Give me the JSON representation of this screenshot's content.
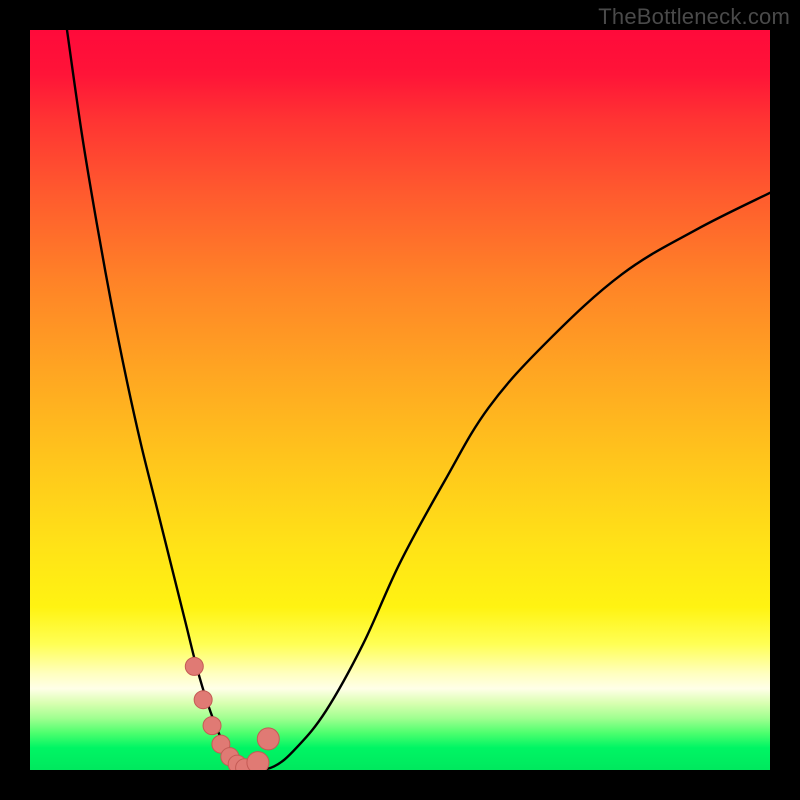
{
  "watermark": "TheBottleneck.com",
  "colors": {
    "frame": "#000000",
    "curve": "#000000",
    "markers_fill": "#e07a74",
    "markers_stroke": "#c45b55"
  },
  "chart_data": {
    "type": "line",
    "title": "",
    "xlabel": "",
    "ylabel": "",
    "xlim": [
      0,
      100
    ],
    "ylim": [
      0,
      100
    ],
    "grid": false,
    "legend": false,
    "series": [
      {
        "name": "bottleneck-curve",
        "x": [
          5,
          7,
          9,
          11,
          13,
          15,
          17,
          19,
          21,
          22.5,
          24,
          25.5,
          27,
          28.5,
          30,
          33,
          36,
          40,
          45,
          50,
          56,
          62,
          70,
          80,
          90,
          100
        ],
        "values": [
          100,
          86,
          74,
          63,
          53,
          44,
          36,
          28,
          20,
          14,
          9,
          5,
          2,
          0.5,
          0,
          0.5,
          3,
          8,
          17,
          28,
          39,
          49,
          58,
          67,
          73,
          78
        ]
      }
    ],
    "markers": {
      "name": "highlight-dots",
      "x": [
        22.2,
        23.4,
        24.6,
        25.8,
        27.0,
        28.0,
        29.0,
        30.8,
        32.2
      ],
      "values": [
        14.0,
        9.5,
        6.0,
        3.5,
        1.8,
        0.8,
        0.3,
        1.0,
        4.2
      ],
      "radius": [
        9,
        9,
        9,
        9,
        9,
        9,
        9,
        11,
        11
      ]
    }
  }
}
